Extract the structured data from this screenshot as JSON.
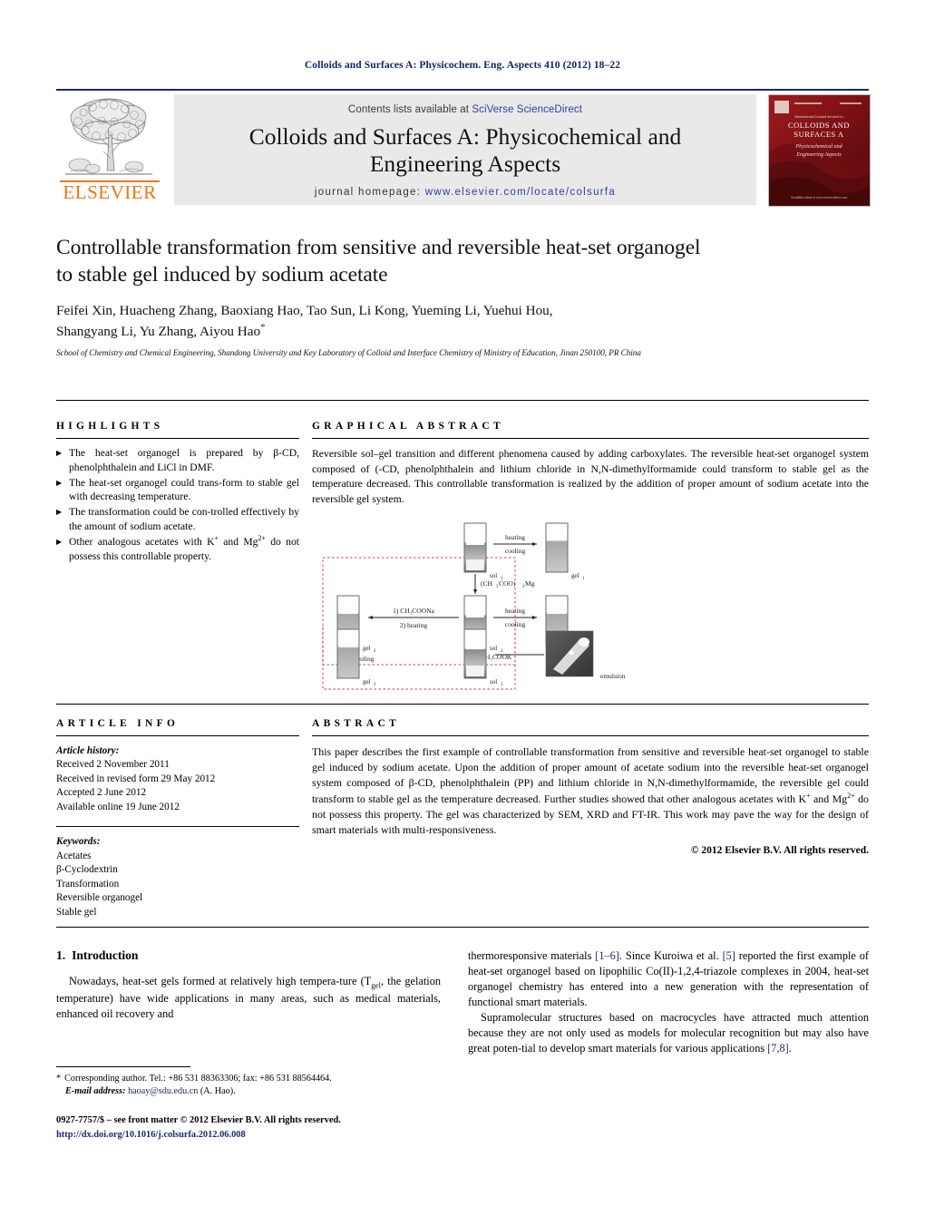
{
  "running_head": "Colloids and Surfaces A: Physicochem. Eng. Aspects 410 (2012) 18–22",
  "masthead": {
    "contents_prefix": "Contents lists available at",
    "contents_link": "SciVerse ScienceDirect",
    "journal_title_line1": "Colloids and Surfaces A: Physicochemical and",
    "journal_title_line2": "Engineering Aspects",
    "homepage_prefix": "journal homepage:",
    "homepage_url": "www.elsevier.com/locate/colsurfa",
    "publisher": "ELSEVIER",
    "cover_title_line1": "COLLOIDS AND",
    "cover_title_line2": "SURFACES A",
    "cover_sub_line1": "Physicochemical and",
    "cover_sub_line2": "Engineering Aspects"
  },
  "article": {
    "title_line1": "Controllable transformation from sensitive and reversible heat-set organogel",
    "title_line2": "to stable gel induced by sodium acetate",
    "authors_line1": "Feifei Xin, Huacheng Zhang, Baoxiang Hao, Tao Sun, Li Kong, Yueming Li, Yuehui Hou,",
    "authors_line2": "Shangyang Li, Yu Zhang, Aiyou Hao",
    "affiliation": "School of Chemistry and Chemical Engineering, Shandong University and Key Laboratory of Colloid and Interface Chemistry of Ministry of Education, Jinan 250100, PR China"
  },
  "highlights": {
    "heading": "HIGHLIGHTS",
    "items": [
      "The heat-set organogel is prepared by β-CD, phenolphthalein and LiCl in DMF.",
      "The heat-set organogel could transform to stable gel with decreasing temperature.",
      "The transformation could be controlled effectively by the amount of sodium acetate.",
      "Other analogous acetates with K+ and Mg2+ do not possess this controllable property."
    ]
  },
  "graphical_abstract": {
    "heading": "GRAPHICAL ABSTRACT",
    "text": "Reversible sol–gel transition and different phenomena caused by adding carboxylates. The reversible heat-set organogel system composed of (-CD, phenolphthalein and lithium chloride in N,N-dimethylformamide could transform to stable gel as the temperature decreased. This controllable transformation is realized by the addition of proper amount of sodium acetate into the reversible gel system.",
    "figure_labels": {
      "sol1": "sol₁",
      "gel1": "gel₁",
      "mg_reagent": "(CH₃COO)₂Mg",
      "na_reagent_line1": "1) CH₃COONa",
      "na_reagent_line2": "2) heating",
      "cooling": "cooling",
      "gel2": "gel₂",
      "gel3": "gel₃",
      "k_reagent": "CH₃COOK",
      "sol2": "sol₂",
      "sol3": "sol₃",
      "gel_mid": "gel₂",
      "heating": "heating",
      "emulsion": "emulsion"
    }
  },
  "article_info": {
    "heading": "ARTICLE INFO",
    "history_label": "Article history:",
    "history": [
      "Received 2 November 2011",
      "Received in revised form 29 May 2012",
      "Accepted 2 June 2012",
      "Available online 19 June 2012"
    ],
    "keywords_label": "Keywords:",
    "keywords": [
      "Acetates",
      "β-Cyclodextrin",
      "Transformation",
      "Reversible organogel",
      "Stable gel"
    ]
  },
  "abstract": {
    "heading": "ABSTRACT",
    "text_part1": "This paper describes the first example of controllable transformation from sensitive and reversible heat-set organogel to stable gel induced by sodium acetate. Upon the addition of proper amount of acetate sodium into the reversible heat-set organogel system composed of β-CD, phenolphthalein (PP) and lithium chloride in N,N-dimethylformamide, the reversible gel could transform to stable gel as the temperature decreased. Further studies showed that other analogous acetates with K",
    "sup1": "+",
    "text_part2": " and Mg",
    "sup2": "2+",
    "text_part3": " do not possess this property. The gel was characterized by SEM, XRD and FT-IR. This work may pave the way for the design of smart materials with multi-responsiveness.",
    "copyright": "© 2012 Elsevier B.V. All rights reserved."
  },
  "introduction": {
    "number": "1.",
    "heading": "Introduction",
    "left_part1": "Nowadays, heat-set gels formed at relatively high tempera-ture (T",
    "left_sub": "gel",
    "left_part2": ", the gelation temperature) have wide applications in many areas, such as medical materials, enhanced oil recovery and",
    "right_p1_a": "thermoresponsive materials ",
    "right_p1_ref1": "[1–6]",
    "right_p1_b": ". Since Kuroiwa et al. ",
    "right_p1_ref2": "[5]",
    "right_p1_c": " reported the first example of heat-set organogel based on lipophilic Co(II)-1,2,4-triazole complexes in 2004, heat-set organogel chemistry has entered into a new generation with the representation of functional smart materials.",
    "right_p2_a": "Supramolecular structures based on macrocycles have attracted much attention because they are not only used as models for molecular recognition but may also have great poten-tial to develop smart materials for various applications ",
    "right_p2_ref": "[7,8]",
    "right_p2_b": "."
  },
  "footnote": {
    "star": "*",
    "corresponding": "Corresponding author. Tel.: +86 531 88363306; fax: +86 531 88564464.",
    "email_label": "E-mail address:",
    "email": "haoay@sdu.edu.cn",
    "email_suffix": "(A. Hao).",
    "imprint": "0927-7757/$ – see front matter © 2012 Elsevier B.V. All rights reserved.",
    "doi": "http://dx.doi.org/10.1016/j.colsurfa.2012.06.008"
  },
  "colors": {
    "navy": "#12226b",
    "link_blue": "#2d3fa8",
    "elsevier_orange": "#e77817",
    "cover_red": "#8c1418",
    "figure_red_dash": "#e06666"
  }
}
